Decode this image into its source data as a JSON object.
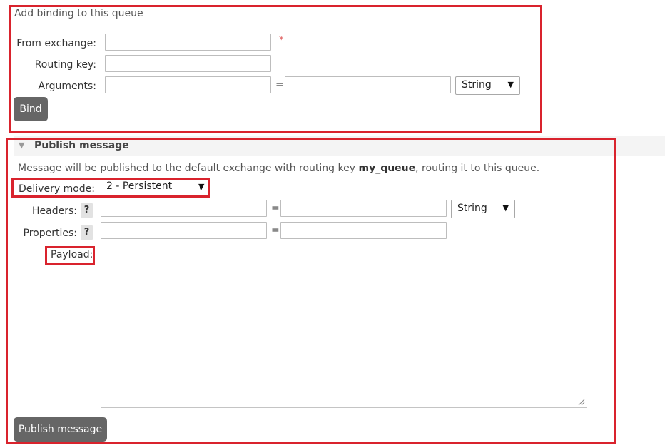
{
  "binding": {
    "title": "Add binding to this queue",
    "from_exchange_label": "From exchange:",
    "required_marker": "*",
    "routing_key_label": "Routing key:",
    "arguments_label": "Arguments:",
    "equals": "=",
    "type_select_value": "String",
    "bind_button": "Bind"
  },
  "publish": {
    "section_title": "Publish message",
    "info_before": "Message will be published to the default exchange with routing key ",
    "routing_key": "my_queue",
    "info_after": ", routing it to this queue.",
    "delivery_mode_label": "Delivery mode:",
    "delivery_mode_value": "2 - Persistent",
    "headers_label": "Headers:",
    "help_glyph": "?",
    "equals": "=",
    "headers_type_value": "String",
    "properties_label": "Properties:",
    "payload_label": "Payload:",
    "publish_button": "Publish message"
  },
  "colors": {
    "highlight_border": "#d9232d",
    "button_bg": "#666666",
    "section_header_bg": "#f4f4f4"
  }
}
